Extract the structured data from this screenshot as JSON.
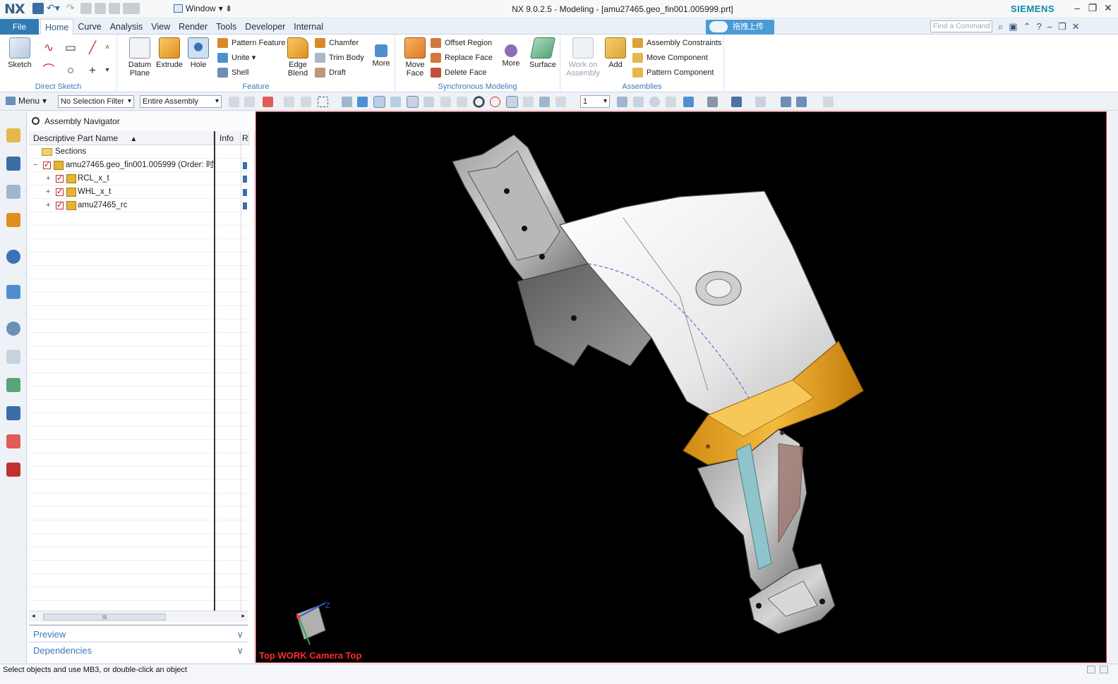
{
  "titlebar": {
    "logo": "NX",
    "window_menu": "Window",
    "title": "NX 9.0.2.5 - Modeling - [amu27465.geo_fin001.005999.prt]",
    "brand": "SIEMENS",
    "minimize": "–",
    "restore": "❐",
    "close": "✕"
  },
  "menubar": {
    "file": "File",
    "tabs": [
      "Home",
      "Curve",
      "Analysis",
      "View",
      "Render",
      "Tools",
      "Developer",
      "Internal"
    ],
    "active_tab": "Home",
    "upload_label": "拖拽上传",
    "find_placeholder": "Find a Command"
  },
  "ribbon": {
    "direct_sketch": {
      "label": "Direct Sketch",
      "sketch": "Sketch"
    },
    "feature": {
      "label": "Feature",
      "datum_plane": "Datum Plane",
      "extrude": "Extrude",
      "hole": "Hole",
      "pattern_feature": "Pattern Feature",
      "unite": "Unite",
      "shell": "Shell",
      "edge_blend": "Edge Blend",
      "chamfer": "Chamfer",
      "trim_body": "Trim Body",
      "draft": "Draft",
      "more": "More"
    },
    "sync": {
      "label": "Synchronous Modeling",
      "move_face": "Move Face",
      "offset_region": "Offset Region",
      "replace_face": "Replace Face",
      "delete_face": "Delete Face",
      "more": "More",
      "surface": "Surface"
    },
    "assemblies": {
      "label": "Assemblies",
      "work_on_assembly": "Work on Assembly",
      "add": "Add",
      "assembly_constraints": "Assembly Constraints",
      "move_component": "Move Component",
      "pattern_component": "Pattern Component"
    }
  },
  "toolbar": {
    "menu": "Menu",
    "selection_filter": "No Selection Filter",
    "scope": "Entire Assembly",
    "layer": "1"
  },
  "navigator": {
    "title": "Assembly Navigator",
    "columns": [
      "Descriptive Part Name",
      "Info",
      "R"
    ],
    "sections": "Sections",
    "root": "amu27465.geo_fin001.005999 (Order: 时...",
    "children": [
      "RCL_x_t",
      "WHL_x_t",
      "amu27465_rc"
    ],
    "scroll_thumb": "III",
    "preview": "Preview",
    "dependencies": "Dependencies"
  },
  "viewport": {
    "view_label": "Top WORK Camera Top",
    "triad_z": "Z"
  },
  "status": {
    "message": "Select objects and use MB3, or double-click an object"
  },
  "colors": {
    "accent": "#2f7ab3",
    "group_label": "#3b79b8",
    "viewport_bg": "#000000",
    "view_label": "#ff2a2a",
    "part_orange": "#e8a51c"
  }
}
